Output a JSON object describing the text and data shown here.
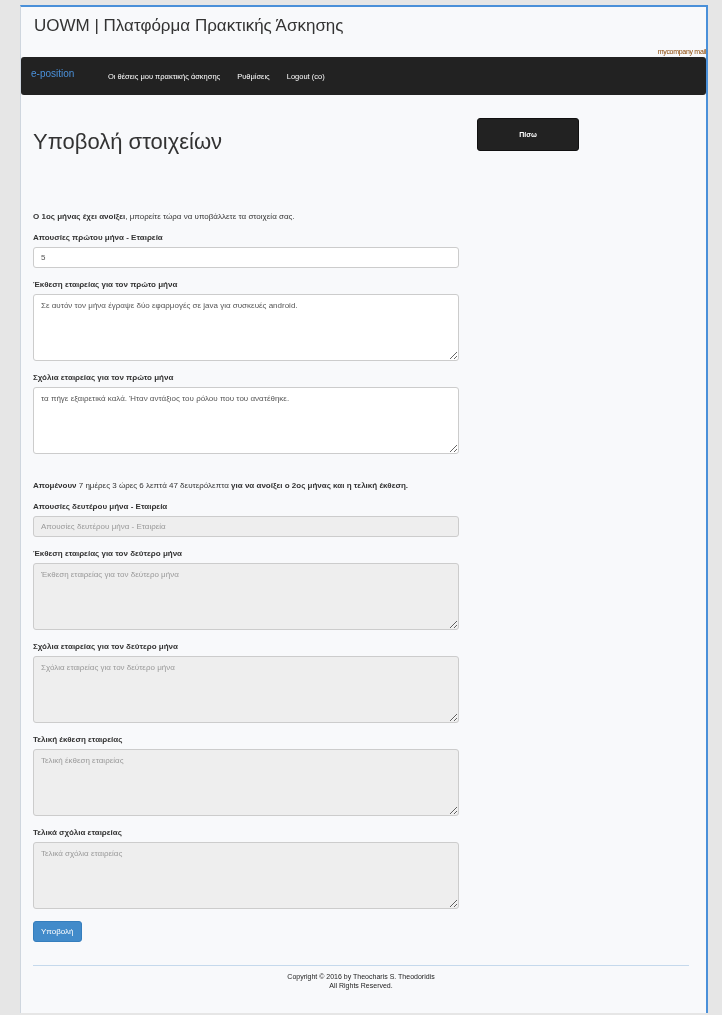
{
  "site_title": "UOWM | Πλατφόρμα Πρακτικής Άσκησης",
  "user_link": "mycompany mail",
  "navbar": {
    "brand": "e-position",
    "items": [
      "Οι θέσεις μου πρακτικής άσκησης",
      "Ρυθμίσεις",
      "Logout (co)"
    ]
  },
  "page_title": "Υποβολή στοιχείων",
  "back_button": "Πίσω",
  "sections": [
    {
      "notice": "**Ο 1ος μήνας έχει ανοίξει**, μπορείτε τώρα να υποβάλλετε τα στοιχεία σας.",
      "fields": [
        {
          "label": "Απουσίες πρώτου μήνα - Εταιρεία",
          "kind": "input",
          "value": "5",
          "disabled": false
        },
        {
          "label": "Έκθεση εταιρείας για τον πρώτο μήνα",
          "kind": "textarea",
          "value": "Σε αυτόν τον μήνα έγραψε δύο εφαρμογές σε java για συσκευές android.",
          "disabled": false
        },
        {
          "label": "Σχόλια εταιρείας για τον πρώτο μήνα",
          "kind": "textarea",
          "value": "τα πήγε εξαιρετικά καλά. Ήταν αντάξιος του ρόλου που του ανατέθηκε.",
          "disabled": false
        }
      ]
    },
    {
      "notice": "**Απομένουν** 7 ημέρες 3 ώρες 6 λεπτά 47 δευτερόλεπτα **για να ανοίξει ο 2ος μήνας και η τελική έκθεση.**",
      "fields": [
        {
          "label": "Απουσίες δευτέρου μήνα - Εταιρεία",
          "kind": "input",
          "placeholder": "Απουσίες δευτέρου μήνα - Εταιρεία",
          "disabled": true
        },
        {
          "label": "Έκθεση εταιρείας για τον δεύτερο μήνα",
          "kind": "textarea",
          "placeholder": "Έκθεση εταιρείας για τον δεύτερο μήνα",
          "disabled": true
        },
        {
          "label": "Σχόλια εταιρείας για τον δεύτερο μήνα",
          "kind": "textarea",
          "placeholder": "Σχόλια εταιρείας για τον δεύτερο μήνα",
          "disabled": true
        },
        {
          "label": "Τελική έκθεση εταιρείας",
          "kind": "textarea",
          "placeholder": "Τελική έκθεση εταιρείας",
          "disabled": true
        },
        {
          "label": "Τελικά σχόλια εταιρείας",
          "kind": "textarea",
          "placeholder": "Τελικά σχόλια εταιρείας",
          "disabled": true
        }
      ]
    }
  ],
  "submit_button": "Υποβολή",
  "footer": [
    "Copyright © 2016 by Theocharis S. Theodoridis",
    "All Rights Reserved."
  ]
}
